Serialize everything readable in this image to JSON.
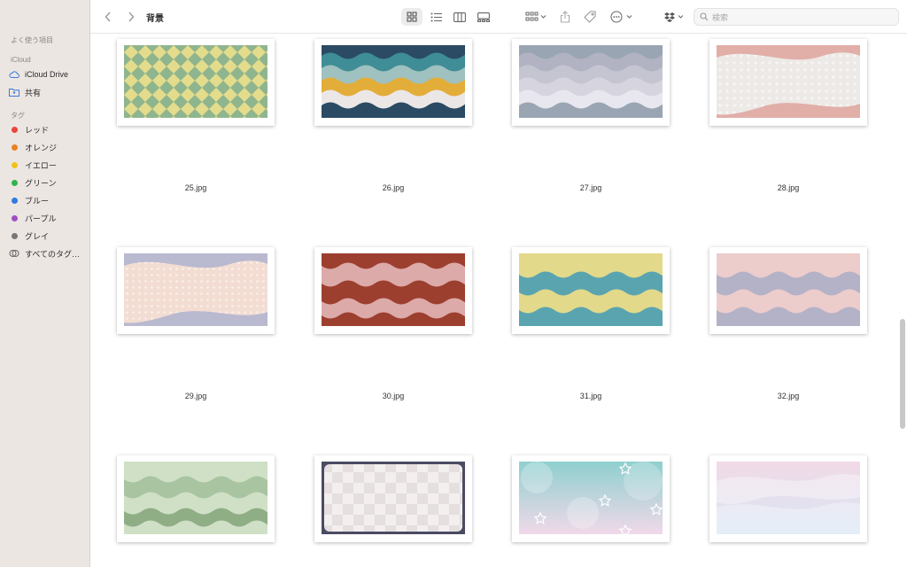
{
  "toolbar": {
    "title": "背景",
    "search_placeholder": "検索"
  },
  "sidebar": {
    "favorites_header": "よく使う項目",
    "icloud_header": "iCloud",
    "icloud_items": [
      {
        "label": "iCloud Drive"
      },
      {
        "label": "共有"
      }
    ],
    "tags_header": "タグ",
    "tags": [
      {
        "label": "レッド",
        "color": "#e8453c"
      },
      {
        "label": "オレンジ",
        "color": "#e8831f"
      },
      {
        "label": "イエロー",
        "color": "#f2c21b"
      },
      {
        "label": "グリーン",
        "color": "#2fb44a"
      },
      {
        "label": "ブルー",
        "color": "#2f79e4"
      },
      {
        "label": "パープル",
        "color": "#a04fc4"
      },
      {
        "label": "グレイ",
        "color": "#777777"
      }
    ],
    "all_tags": "すべてのタグ…"
  },
  "files": [
    {
      "name": "25.jpg"
    },
    {
      "name": "26.jpg"
    },
    {
      "name": "27.jpg"
    },
    {
      "name": "28.jpg"
    },
    {
      "name": "29.jpg"
    },
    {
      "name": "30.jpg"
    },
    {
      "name": "31.jpg"
    },
    {
      "name": "32.jpg"
    }
  ]
}
